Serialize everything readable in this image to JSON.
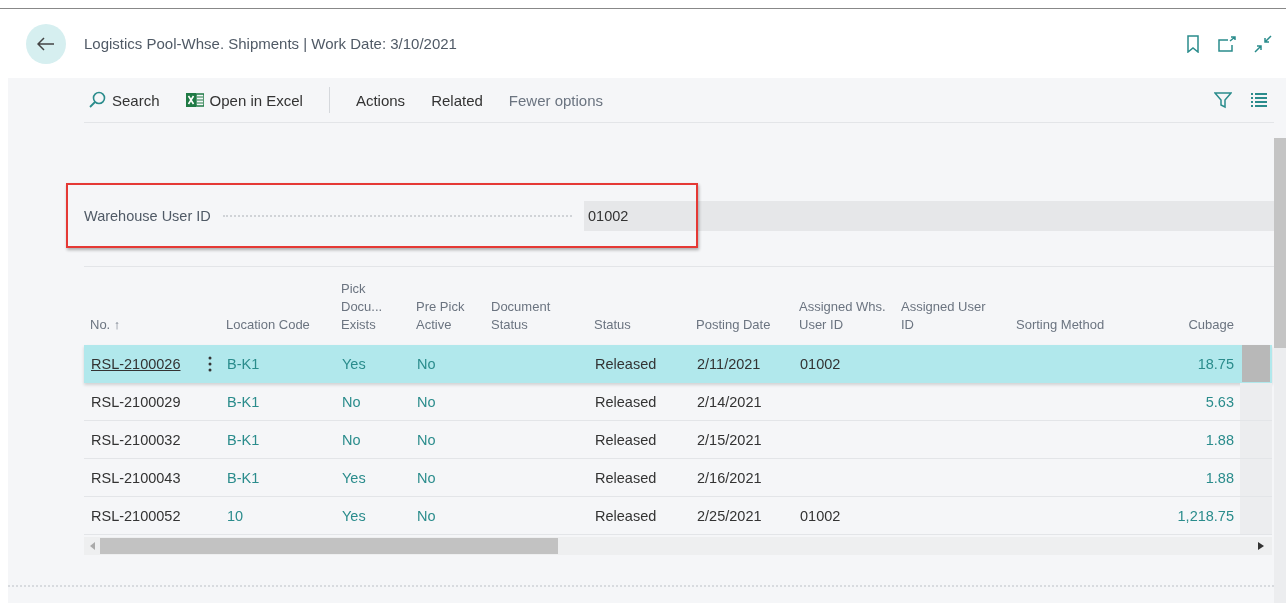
{
  "header": {
    "title": "Logistics Pool-Whse. Shipments | Work Date: 3/10/2021"
  },
  "toolbar": {
    "items": [
      {
        "label": "Search",
        "kind": "search"
      },
      {
        "label": "Open in Excel",
        "kind": "excel"
      },
      {
        "label": "Actions",
        "kind": "menu"
      },
      {
        "label": "Related",
        "kind": "menu"
      },
      {
        "label": "Fewer options",
        "kind": "muted"
      }
    ]
  },
  "field": {
    "label": "Warehouse User ID",
    "value": "01002",
    "highlighted": true
  },
  "table": {
    "columns": [
      {
        "label": "No. ↑",
        "kind": "text"
      },
      {
        "label": "Location Code",
        "kind": "link"
      },
      {
        "label": "Pick Docu... Exists",
        "kind": "link"
      },
      {
        "label": "Pre Pick Active",
        "kind": "link"
      },
      {
        "label": "Document Status",
        "kind": "text"
      },
      {
        "label": "Status",
        "kind": "text"
      },
      {
        "label": "Posting Date",
        "kind": "text"
      },
      {
        "label": "Assigned Whs. User ID",
        "kind": "text"
      },
      {
        "label": "Assigned User ID",
        "kind": "text"
      },
      {
        "label": "Sorting Method",
        "kind": "text"
      },
      {
        "label": "Cubage",
        "kind": "number"
      }
    ],
    "rows": [
      {
        "selected": true,
        "cells": [
          "RSL-2100026",
          "B-K1",
          "Yes",
          "No",
          "",
          "Released",
          "2/11/2021",
          "01002",
          "",
          "",
          "18.75"
        ]
      },
      {
        "selected": false,
        "cells": [
          "RSL-2100029",
          "B-K1",
          "No",
          "No",
          "",
          "Released",
          "2/14/2021",
          "",
          "",
          "",
          "5.63"
        ]
      },
      {
        "selected": false,
        "cells": [
          "RSL-2100032",
          "B-K1",
          "No",
          "No",
          "",
          "Released",
          "2/15/2021",
          "",
          "",
          "",
          "1.88"
        ]
      },
      {
        "selected": false,
        "cells": [
          "RSL-2100043",
          "B-K1",
          "Yes",
          "No",
          "",
          "Released",
          "2/16/2021",
          "",
          "",
          "",
          "1.88"
        ]
      },
      {
        "selected": false,
        "cells": [
          "RSL-2100052",
          "10",
          "Yes",
          "No",
          "",
          "Released",
          "2/25/2021",
          "01002",
          "",
          "",
          "1,218.75"
        ]
      }
    ]
  }
}
